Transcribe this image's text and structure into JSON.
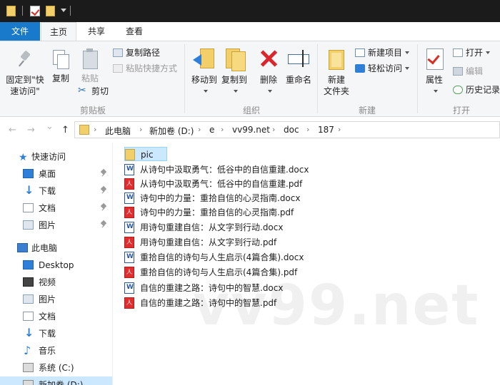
{
  "ribbon_tabs": {
    "file": "文件",
    "home": "主页",
    "share": "共享",
    "view": "查看"
  },
  "clipboard": {
    "pin_line1": "固定到\"快",
    "pin_line2": "速访问\"",
    "copy": "复制",
    "paste": "粘贴",
    "copy_path": "复制路径",
    "paste_shortcut": "粘贴快捷方式",
    "cut": "剪切",
    "group": "剪贴板"
  },
  "organize": {
    "move_to": "移动到",
    "copy_to": "复制到",
    "delete": "删除",
    "rename": "重命名",
    "group": "组织"
  },
  "new": {
    "new_folder_line1": "新建",
    "new_folder_line2": "文件夹",
    "new_item": "新建项目",
    "easy_access": "轻松访问",
    "group": "新建"
  },
  "open": {
    "properties": "属性",
    "open": "打开",
    "edit": "编辑",
    "history": "历史记录",
    "group": "打开"
  },
  "address": {
    "back": "←",
    "forward": "→",
    "recent": "⌄",
    "up": "↑",
    "crumbs": [
      "此电脑",
      "新加卷 (D:)",
      "e",
      "vv99.net",
      "doc",
      "187"
    ],
    "sep": "›"
  },
  "nav": {
    "quick_access": "快速访问",
    "desktop": "桌面",
    "downloads": "下载",
    "documents": "文档",
    "pictures": "图片",
    "this_pc": "此电脑",
    "desktop_en": "Desktop",
    "videos": "视频",
    "pictures2": "图片",
    "documents2": "文档",
    "downloads2": "下载",
    "music": "音乐",
    "system_c": "系统 (C:)",
    "new_vol_d": "新加卷 (D:)"
  },
  "files": [
    {
      "name": "pic",
      "type": "folder"
    },
    {
      "name": "从诗句中汲取勇气：低谷中的自信重建.docx",
      "type": "docx"
    },
    {
      "name": "从诗句中汲取勇气：低谷中的自信重建.pdf",
      "type": "pdf"
    },
    {
      "name": "诗句中的力量：重拾自信的心灵指南.docx",
      "type": "docx"
    },
    {
      "name": "诗句中的力量：重拾自信的心灵指南.pdf",
      "type": "pdf"
    },
    {
      "name": "用诗句重建自信：从文字到行动.docx",
      "type": "docx"
    },
    {
      "name": "用诗句重建自信：从文字到行动.pdf",
      "type": "pdf"
    },
    {
      "name": "重拾自信的诗句与人生启示(4篇合集).docx",
      "type": "docx"
    },
    {
      "name": "重拾自信的诗句与人生启示(4篇合集).pdf",
      "type": "pdf"
    },
    {
      "name": "自信的重建之路：诗句中的智慧.docx",
      "type": "docx"
    },
    {
      "name": "自信的重建之路：诗句中的智慧.pdf",
      "type": "pdf"
    }
  ],
  "watermark": "vv99.net",
  "colors": {
    "file_tab": "#1979ca",
    "selection": "#cce8ff",
    "folder": "#f3cf6a",
    "pdf": "#e02e2e",
    "docx": "#2b579a"
  }
}
